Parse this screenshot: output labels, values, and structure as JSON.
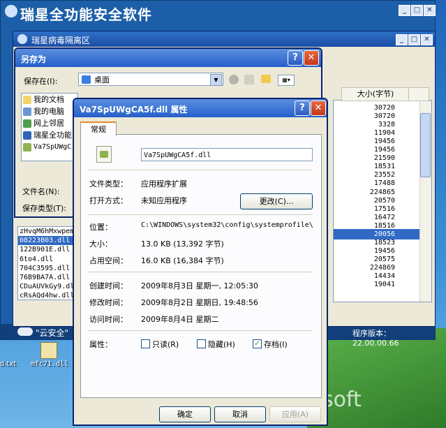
{
  "main_window": {
    "title": "瑞星全功能安全软件",
    "cloud_label": "\"云安全\"",
    "version": "程序版本：22.00.00.66"
  },
  "desktop": {
    "icon1_label": "d.txt",
    "icon2_label": "mfc71.dll",
    "brand": "soft"
  },
  "quarantine_window": {
    "title": "瑞星病毒隔离区",
    "size_header": "大小(字节)",
    "sizes": [
      "30720",
      "30720",
      "3328",
      "11904",
      "19456",
      "19456",
      "21590",
      "18531",
      "23552",
      "17488",
      "224865",
      "20570",
      "17516",
      "16472",
      "18516",
      "20056",
      "18523",
      "19456",
      "20575",
      "224869",
      "14434",
      "19041"
    ],
    "selected_size_index": 15,
    "left_files": [
      "zHvqM6hMxwpem",
      "08223B03.dll",
      "122B901E.dll",
      "6to4.dll",
      "704C3595.dll",
      "76B9BA7A.dll",
      "CDuAUVkGy9.dll",
      "cRsAQd4hw.dll"
    ],
    "selected_left_index": 1
  },
  "save_as": {
    "title": "另存为",
    "save_in_label": "保存在(I):",
    "save_in_value": "桌面",
    "tree": [
      "我的文档",
      "我的电脑",
      "网上邻居",
      "瑞星全功能",
      "Va7SpUWgC"
    ],
    "filename_label": "文件名(N):",
    "filetype_label": "保存类型(T):"
  },
  "properties": {
    "title": "Va7SpUWgCA5f.dll 属性",
    "tab": "常规",
    "filename": "Va7SpUWgCA5f.dll",
    "file_type_label": "文件类型：",
    "file_type_value": "应用程序扩展",
    "open_with_label": "打开方式：",
    "open_with_value": "未知应用程序",
    "change_button": "更改(C)...",
    "location_label": "位置：",
    "location_value": "C:\\WINDOWS\\system32\\config\\systemprofile\\",
    "size_label": "大小：",
    "size_value": "13.0 KB (13,392 字节)",
    "disk_size_label": "占用空间：",
    "disk_size_value": "16.0 KB (16,384 字节)",
    "created_label": "创建时间：",
    "created_value": "2009年8月3日 星期一, 12:05:30",
    "modified_label": "修改时间：",
    "modified_value": "2009年8月2日 星期日, 19:48:56",
    "accessed_label": "访问时间：",
    "accessed_value": "2009年8月4日 星期二",
    "attributes_label": "属性：",
    "readonly_label": "只读(R)",
    "hidden_label": "隐藏(H)",
    "archive_label": "存档(I)",
    "readonly_checked": false,
    "hidden_checked": false,
    "archive_checked": true,
    "ok_button": "确定",
    "cancel_button": "取消",
    "apply_button": "应用(A)"
  }
}
